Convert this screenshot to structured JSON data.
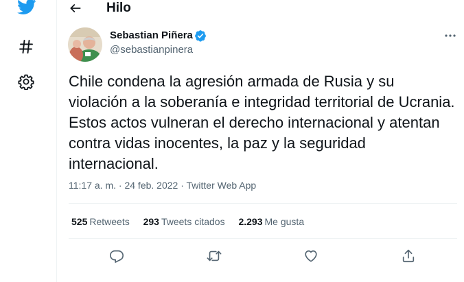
{
  "sidebar": {
    "items": [
      {
        "icon": "twitter-bird-icon"
      },
      {
        "icon": "hashtag-icon"
      },
      {
        "icon": "gear-icon"
      }
    ],
    "brand_color": "#1d9bf0"
  },
  "header": {
    "title": "Hilo"
  },
  "tweet": {
    "author_name": "Sebastian Piñera",
    "handle": "@sebastianpinera",
    "verified": true,
    "text": "Chile condena la agresión armada de Rusia y su violación a la soberanía e integridad territorial de Ucrania. Estos actos vulneran el derecho internacional y atentan contra vidas inocentes, la paz y la seguridad internacional.",
    "time": "11:17 a. m.",
    "separator": "·",
    "date": "24 feb. 2022",
    "source": "Twitter Web App"
  },
  "stats": {
    "retweets_count": "525",
    "retweets_label": "Retweets",
    "quotes_count": "293",
    "quotes_label": "Tweets citados",
    "likes_count": "2.293",
    "likes_label": "Me gusta"
  },
  "actions": [
    {
      "icon": "reply-icon"
    },
    {
      "icon": "retweet-icon"
    },
    {
      "icon": "like-icon"
    },
    {
      "icon": "share-icon"
    }
  ],
  "colors": {
    "text": "#0f1419",
    "secondary": "#536471",
    "accent": "#1d9bf0",
    "divider": "#eff3f4"
  }
}
